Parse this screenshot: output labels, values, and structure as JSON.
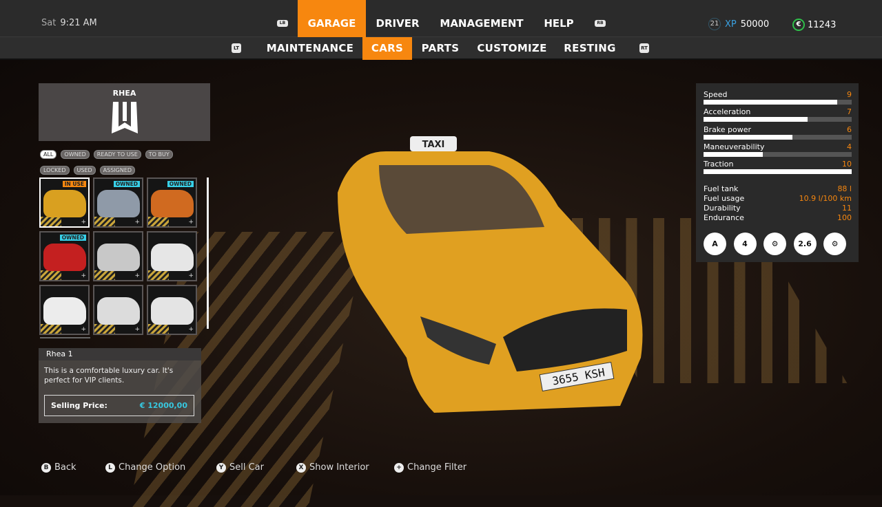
{
  "header": {
    "day": "Sat",
    "time": "9:21 AM",
    "lb": "LB",
    "rb": "RB",
    "tabs": [
      {
        "label": "GARAGE",
        "active": true
      },
      {
        "label": "DRIVER"
      },
      {
        "label": "MANAGEMENT"
      },
      {
        "label": "HELP"
      }
    ],
    "level": "21",
    "xp_label": "XP",
    "xp": "50000",
    "currency_icon": "€",
    "money": "11243"
  },
  "subnav": {
    "lt": "LT",
    "rt": "RT",
    "tabs": [
      {
        "label": "MAINTENANCE"
      },
      {
        "label": "CARS",
        "active": true
      },
      {
        "label": "PARTS"
      },
      {
        "label": "CUSTOMIZE"
      },
      {
        "label": "RESTING"
      }
    ]
  },
  "brand": {
    "name": "RHEA"
  },
  "filters": [
    {
      "label": "ALL",
      "active": true
    },
    {
      "label": "OWNED"
    },
    {
      "label": "READY TO USE"
    },
    {
      "label": "TO BUY"
    },
    {
      "label": "LOCKED"
    },
    {
      "label": "USED"
    },
    {
      "label": "ASSIGNED"
    }
  ],
  "cars": [
    {
      "badge": "IN USE",
      "badge_color": "#f7870f",
      "color": "#d9a020",
      "selected": true
    },
    {
      "badge": "OWNED",
      "badge_color": "#37d0e8",
      "color": "#8f9aa8"
    },
    {
      "badge": "OWNED",
      "badge_color": "#37d0e8",
      "color": "#d06a20"
    },
    {
      "badge": "OWNED",
      "badge_color": "#37d0e8",
      "color": "#c42020"
    },
    {
      "badge": "",
      "color": "#c8c8c8"
    },
    {
      "badge": "",
      "color": "#e6e6e6"
    },
    {
      "badge": "",
      "color": "#ececec"
    },
    {
      "badge": "",
      "color": "#dcdcdc"
    },
    {
      "badge": "",
      "color": "#e4e4e4"
    }
  ],
  "info": {
    "title": "Rhea 1",
    "description": "This is a comfortable luxury car. It's perfect for VIP clients.",
    "price_label": "Selling Price:",
    "price": "€ 12000,00"
  },
  "stats": [
    {
      "label": "Speed",
      "value": "9",
      "fraction": 0.9
    },
    {
      "label": "Acceleration",
      "value": "7",
      "fraction": 0.7
    },
    {
      "label": "Brake power",
      "value": "6",
      "fraction": 0.6
    },
    {
      "label": "Maneuverability",
      "value": "4",
      "fraction": 0.4
    },
    {
      "label": "Traction",
      "value": "10",
      "fraction": 1.0
    }
  ],
  "specs": [
    {
      "label": "Fuel tank",
      "value": "88 l"
    },
    {
      "label": "Fuel usage",
      "value": "10.9 l/100 km"
    },
    {
      "label": "Durability",
      "value": "11"
    },
    {
      "label": "Endurance",
      "value": "100"
    }
  ],
  "features": [
    {
      "icon": "automatic-transmission-icon",
      "text": "A"
    },
    {
      "icon": "seats-icon",
      "text": "4"
    },
    {
      "icon": "engine-power-icon",
      "text": ""
    },
    {
      "icon": "weight-icon",
      "text": "2.6"
    },
    {
      "icon": "engine-icon",
      "text": ""
    }
  ],
  "car_view": {
    "roof_sign": "TAXI",
    "plate": "3655 KSH",
    "color": "#e0a021"
  },
  "hints": [
    {
      "button": "B",
      "label": "Back"
    },
    {
      "button": "L",
      "label": "Change Option"
    },
    {
      "button": "Y",
      "label": "Sell Car"
    },
    {
      "button": "X",
      "label": "Show Interior"
    },
    {
      "button": "+",
      "label": "Change Filter"
    }
  ]
}
